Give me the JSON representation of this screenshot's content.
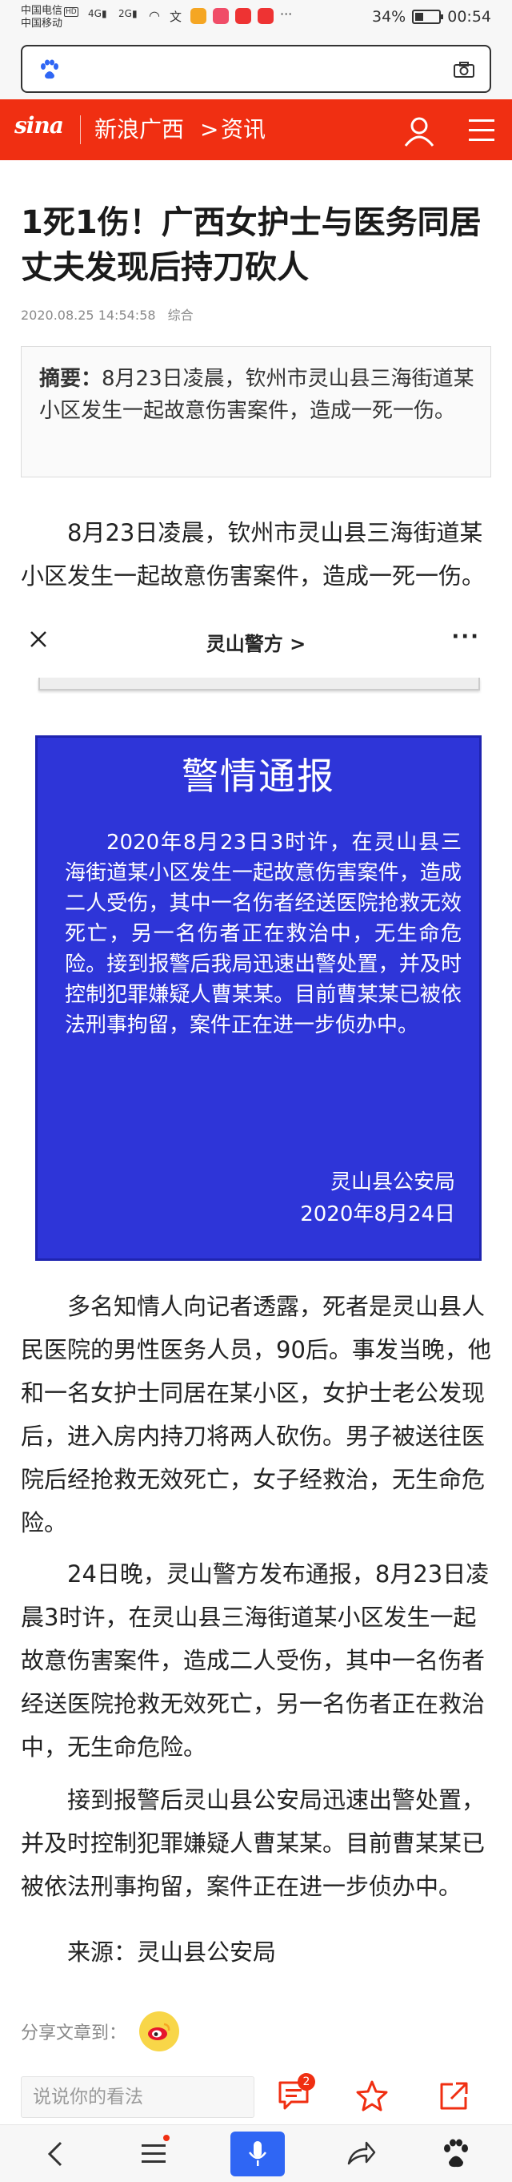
{
  "status_bar": {
    "carrier1": "中国电信",
    "hd": "HD",
    "carrier2": "中国移动",
    "net1": "4G",
    "net2": "2G",
    "more": "···",
    "battery": "34%",
    "time": "00:54"
  },
  "header": {
    "logo": "sina",
    "channel": "新浪广西",
    "separator": ">",
    "section": "资讯"
  },
  "article": {
    "title": "1死1伤！广西女护士与医务同居丈夫发现后持刀砍人",
    "date": "2020.08.25 14:54:58",
    "category": "综合",
    "summary_label": "摘要：",
    "summary_text": "8月23日凌晨，钦州市灵山县三海街道某小区发生一起故意伤害案件，造成一死一伤。",
    "para1": "8月23日凌晨，钦州市灵山县三海街道某小区发生一起故意伤害案件，造成一死一伤。",
    "para2": "多名知情人向记者透露，死者是灵山县人民医院的男性医务人员，90后。事发当晚，他和一名女护士同居在某小区，女护士老公发现后，进入房内持刀将两人砍伤。男子被送往医院后经抢救无效死亡，女子经救治，无生命危险。",
    "para3": "24日晚，灵山警方发布通报，8月23日凌晨3时许，在灵山县三海街道某小区发生一起故意伤害案件，造成二人受伤，其中一名伤者经送医院抢救无效死亡，另一名伤者正在救治中，无生命危险。",
    "para4": "接到报警后灵山县公安局迅速出警处置，并及时控制犯罪嫌疑人曹某某。目前曹某某已被依法刑事拘留，案件正在进一步侦办中。",
    "source": "来源：灵山县公安局"
  },
  "embed": {
    "account": "灵山警方",
    "chevron": ">",
    "more": "···"
  },
  "police_notice": {
    "title": "警情通报",
    "body": "2020年8月23日3时许，在灵山县三海街道某小区发生一起故意伤害案件，造成二人受伤，其中一名伤者经送医院抢救无效死亡，另一名伤者正在救治中，无生命危险。接到报警后我局迅速出警处置，并及时控制犯罪嫌疑人曹某某。目前曹某某已被依法刑事拘留，案件正在进一步侦办中。",
    "org": "灵山县公安局",
    "date": "2020年8月24日"
  },
  "share": {
    "label": "分享文章到："
  },
  "comment_bar": {
    "placeholder": "说说你的看法",
    "comment_count": "2"
  },
  "colors": {
    "brand_red": "#f02f12",
    "notice_blue": "#2e35d8",
    "mic_blue": "#2f66f4"
  }
}
